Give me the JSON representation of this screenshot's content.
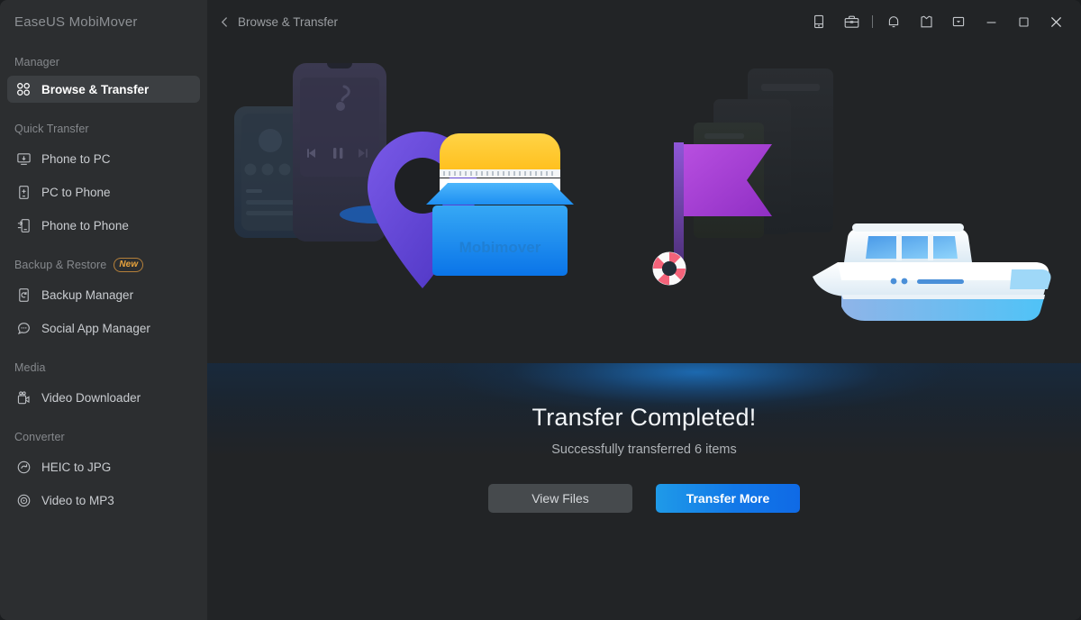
{
  "app": {
    "brand": "EaseUS MobiMover"
  },
  "sidebar": {
    "groups": [
      {
        "label": "Manager",
        "badge": null,
        "items": [
          {
            "label": "Browse & Transfer",
            "icon": "grid-icon",
            "active": true
          }
        ]
      },
      {
        "label": "Quick Transfer",
        "badge": null,
        "items": [
          {
            "label": "Phone to PC",
            "icon": "phone-to-pc-icon",
            "active": false
          },
          {
            "label": "PC to Phone",
            "icon": "pc-to-phone-icon",
            "active": false
          },
          {
            "label": "Phone to Phone",
            "icon": "phone-to-phone-icon",
            "active": false
          }
        ]
      },
      {
        "label": "Backup & Restore",
        "badge": "New",
        "items": [
          {
            "label": "Backup Manager",
            "icon": "backup-icon",
            "active": false
          },
          {
            "label": "Social App Manager",
            "icon": "chat-bubble-icon",
            "active": false
          }
        ]
      },
      {
        "label": "Media",
        "badge": null,
        "items": [
          {
            "label": "Video Downloader",
            "icon": "video-camera-icon",
            "active": false
          }
        ]
      },
      {
        "label": "Converter",
        "badge": null,
        "items": [
          {
            "label": "HEIC to JPG",
            "icon": "heic-convert-icon",
            "active": false
          },
          {
            "label": "Video to MP3",
            "icon": "video-play-icon",
            "active": false
          }
        ]
      }
    ]
  },
  "titlebar": {
    "breadcrumb": "Browse & Transfer",
    "back_icon": "chevron-left-icon",
    "icons": [
      {
        "name": "device-icon"
      },
      {
        "name": "toolbox-icon"
      },
      {
        "name": "bell-icon"
      },
      {
        "name": "skin-theme-icon"
      },
      {
        "name": "menu-dropdown-icon"
      }
    ],
    "window_controls": [
      {
        "name": "minimize-button"
      },
      {
        "name": "maximize-button"
      },
      {
        "name": "close-button"
      }
    ]
  },
  "main": {
    "headline": "Transfer Completed!",
    "subline": "Successfully transferred 6 items",
    "buttons": {
      "view_files": "View Files",
      "transfer_more": "Transfer More"
    },
    "illustration": {
      "box_label": "Mobimover"
    }
  },
  "colors": {
    "accent_blue": "#1278e8",
    "badge_amber": "#e8a33d",
    "sidebar_bg": "#2c2e30",
    "main_bg": "#222426",
    "pin_purple": "#5b3fd6",
    "flag_purple": "#a43fd6"
  }
}
